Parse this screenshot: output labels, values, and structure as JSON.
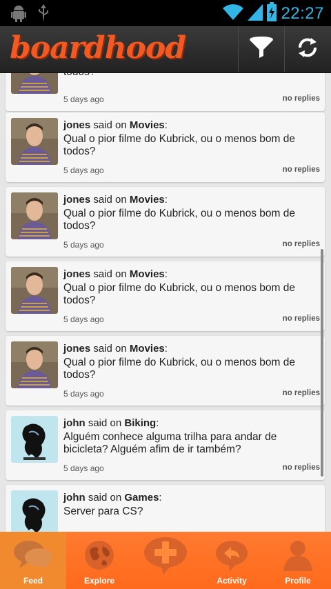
{
  "status_bar": {
    "time": "22:27"
  },
  "app_bar": {
    "logo": "boardhood"
  },
  "feed": {
    "posts": [
      {
        "user": "",
        "said": "",
        "board": "",
        "text": "todos?",
        "time": "5 days ago",
        "replies": "no replies",
        "avatar": "portrait"
      },
      {
        "user": "jones",
        "said": "said on",
        "board": "Movies",
        "text": "Qual o pior filme do Kubrick, ou o menos bom de todos?",
        "time": "5 days ago",
        "replies": "no replies",
        "avatar": "portrait"
      },
      {
        "user": "jones",
        "said": "said on",
        "board": "Movies",
        "text": "Qual o pior filme do Kubrick, ou o menos bom de todos?",
        "time": "5 days ago",
        "replies": "no replies",
        "avatar": "portrait"
      },
      {
        "user": "jones",
        "said": "said on",
        "board": "Movies",
        "text": "Qual o pior filme do Kubrick, ou o menos bom de todos?",
        "time": "5 days ago",
        "replies": "no replies",
        "avatar": "portrait"
      },
      {
        "user": "jones",
        "said": "said on",
        "board": "Movies",
        "text": "Qual o pior filme do Kubrick, ou o menos bom de todos?",
        "time": "5 days ago",
        "replies": "no replies",
        "avatar": "portrait"
      },
      {
        "user": "john",
        "said": "said on",
        "board": "Biking",
        "text": "Alguém conhece alguma trilha para andar de bicicleta? Alguém afim de ir também?",
        "time": "5 days ago",
        "replies": "no replies",
        "avatar": "album"
      },
      {
        "user": "john",
        "said": "said on",
        "board": "Games",
        "text": "Server para CS?",
        "time": "",
        "replies": "",
        "avatar": "album"
      }
    ]
  },
  "bottom_nav": {
    "items": [
      {
        "label": "Feed",
        "icon": "chat-bubbles-icon",
        "active": true
      },
      {
        "label": "Explore",
        "icon": "globe-icon",
        "active": false
      },
      {
        "label": "",
        "icon": "new-post-plus-icon",
        "active": false
      },
      {
        "label": "Activity",
        "icon": "reply-bubble-icon",
        "active": false
      },
      {
        "label": "Profile",
        "icon": "person-icon",
        "active": false
      }
    ]
  },
  "colors": {
    "brand": "#f15a24",
    "nav": "#ff7a30",
    "clock": "#33b5e5"
  }
}
